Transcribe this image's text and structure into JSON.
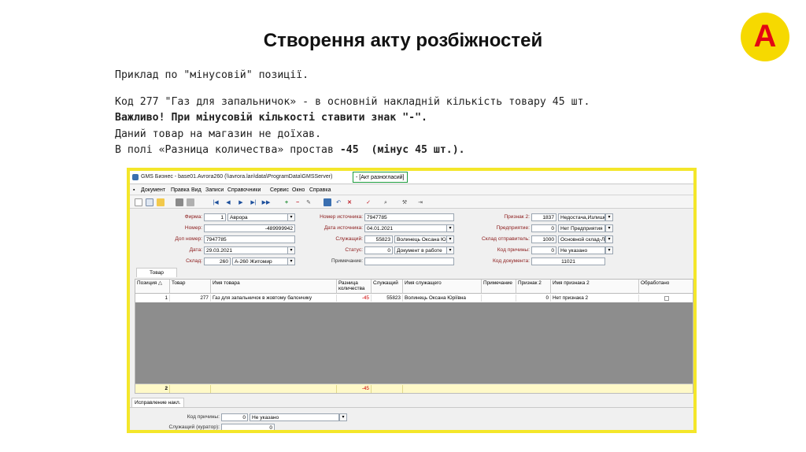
{
  "slide": {
    "title": "Створення акту розбіжностей",
    "logo_letter": "A",
    "line1": "Приклад по \"мінусовій\" позиції.",
    "line2": "Код 277 \"Газ для запальничок» - в основній накладній кількість товару 45 шт.",
    "line3": "Важливо! При мінусовій кількості ставити знак \"-\".",
    "line4": "Даний товар на магазин не доїхав.",
    "line5_a": "В полі «Разница количества» простав ",
    "line5_b": "-45  (мінус 45 шт.).",
    "colors": {
      "logo_bg": "#f6d900",
      "logo_letter": "#e30613",
      "frame": "#f4e62a",
      "highlight": "#1a9a3c"
    }
  },
  "window": {
    "title": "GMS Бизнес - base01.Avrora260 (\\\\avrora.lan\\data\\ProgramData\\GMSServer)",
    "title_highlight": "- [Акт разногласий]",
    "menu": [
      "Документ",
      "Правка",
      "Вид",
      "Записи",
      "Справочники",
      "Сервис",
      "Окно",
      "Справка"
    ],
    "toolbar_icons": [
      "new-icon",
      "copy-icon",
      "open-icon",
      "print-icon",
      "print-preview-icon",
      "first-icon",
      "prev-icon",
      "play-icon",
      "next-icon",
      "last-icon",
      "add-icon",
      "remove-icon",
      "edit-icon",
      "save-icon",
      "undo-icon",
      "cancel-icon",
      "check-icon",
      "search-icon",
      "tools-icon",
      "exit-icon"
    ]
  },
  "form": {
    "firma_label": "Фирма:",
    "firma_code": "1",
    "firma_name": "Аврора",
    "nomer_label": "Номер:",
    "nomer_value": "-489999942",
    "dop_nomer_label": "Доп номер:",
    "dop_nomer_value": "7947785",
    "data_label": "Дата:",
    "data_value": "29.03.2021",
    "sklad_label": "Склад:",
    "sklad_code": "260",
    "sklad_name": "А-260 Житомир",
    "nomer_ist_label": "Номер источника:",
    "nomer_ist_value": "7947785",
    "data_ist_label": "Дата источника:",
    "data_ist_value": "04.01.2021",
    "sluzh_label": "Служащий:",
    "sluzh_code": "55823",
    "sluzh_name": "Волинець Оксана Ю",
    "status_label": "Статус:",
    "status_code": "0",
    "status_name": "Документ в работе",
    "primech_label": "Примечание:",
    "primech_value": "",
    "priznak2_label": "Признак 2:",
    "priznak2_code": "1837",
    "priznak2_name": "Недостача,Излишек",
    "predpr_label": "Предприятие:",
    "predpr_code": "0",
    "predpr_name": "Нет Предприятия",
    "sklad_otpr_label": "Склад отправитель:",
    "sklad_otpr_code": "1000",
    "sklad_otpr_name": "Основной склад-Л",
    "kod_prich_label": "Код причины:",
    "kod_prich_code": "0",
    "kod_prich_name": "Не указано",
    "kod_doc_label": "Код документа:",
    "kod_doc_value": "11021"
  },
  "tab_label": "Товар",
  "grid": {
    "headers": [
      "Позиция △",
      "Товар",
      "Имя товара",
      "Разница количества",
      "Служащий",
      "Имя служащего",
      "Примечание",
      "Признак 2",
      "Имя признака 2",
      "Обработано"
    ],
    "row": [
      "1",
      "277",
      "Газ для запальничок в жовтому балончику",
      "-45",
      "55823",
      "Волинець Оксана Юріївна",
      "",
      "0",
      "Нет признака 2",
      ""
    ],
    "total_position": "2",
    "total_difference": "-45"
  },
  "bottom": {
    "tab_label": "Исправление накл.",
    "kod_prich_label": "Код причины:",
    "kod_prich_code": "0",
    "kod_prich_name": "Не указано",
    "sluzh_label": "Служащий (куратор):",
    "sluzh_code": "0"
  }
}
